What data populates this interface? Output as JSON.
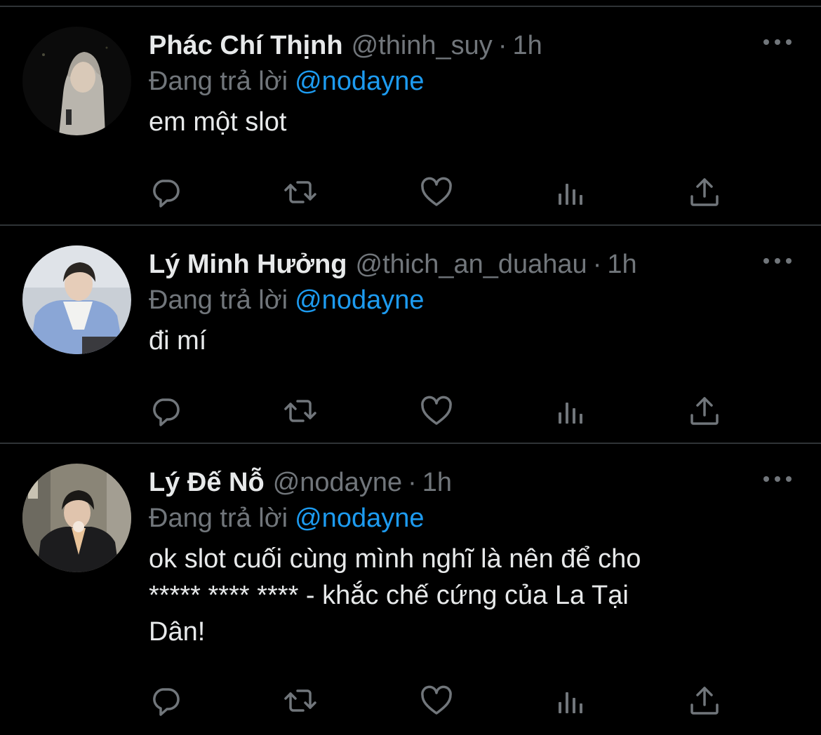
{
  "colors": {
    "background": "#000000",
    "primary_text": "#e7e9ea",
    "secondary_text": "#71767b",
    "accent": "#1d9bf0",
    "divider": "#2f3336"
  },
  "tweets": [
    {
      "display_name": "Phác Chí Thịnh",
      "handle": "@thinh_suy",
      "dot": "·",
      "time": "1h",
      "reply_prefix": "Đang trả lời",
      "reply_to": "@nodayne",
      "text": "em một slot",
      "avatar": "avatar-photo"
    },
    {
      "display_name": "Lý Minh Hưởng",
      "handle": "@thich_an_duahau",
      "dot": "·",
      "time": "1h",
      "reply_prefix": "Đang trả lời",
      "reply_to": "@nodayne",
      "text": "đi mí",
      "avatar": "avatar-photo"
    },
    {
      "display_name": "Lý Đế Nỗ",
      "handle": "@nodayne",
      "dot": "·",
      "time": "1h",
      "reply_prefix": "Đang trả lời",
      "reply_to": "@nodayne",
      "text": "ok slot cuối cùng mình nghĩ là nên để cho\n***** **** **** - khắc chế cứng của La Tại\nDân!",
      "avatar": "avatar-photo"
    }
  ],
  "icons": {
    "reply": "reply-icon",
    "retweet": "retweet-icon",
    "like": "like-icon",
    "stats": "stats-icon",
    "share": "share-icon",
    "more": "more-icon"
  }
}
